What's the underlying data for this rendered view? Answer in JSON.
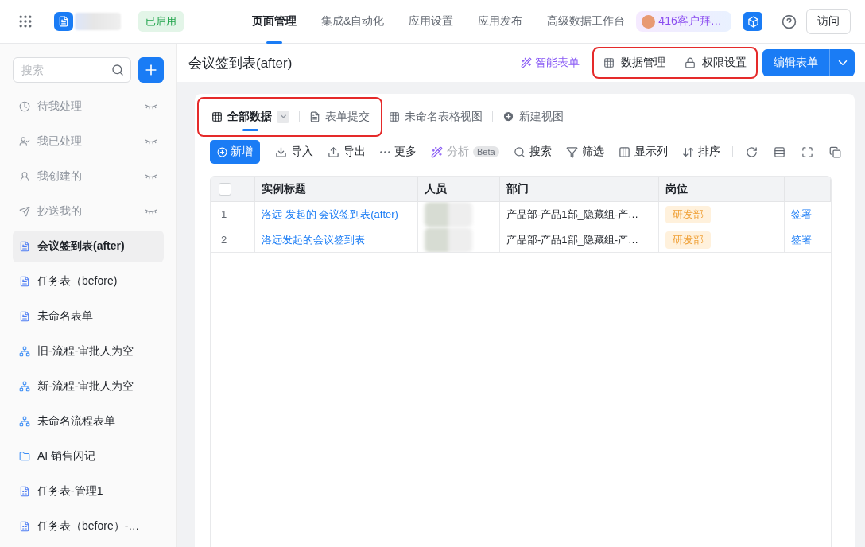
{
  "top_bar": {
    "status_badge": "已启用",
    "nav": [
      {
        "label": "页面管理",
        "selected": true
      },
      {
        "label": "集成&自动化",
        "selected": false
      },
      {
        "label": "应用设置",
        "selected": false
      },
      {
        "label": "应用发布",
        "selected": false
      },
      {
        "label": "高级数据工作台",
        "selected": false
      }
    ],
    "workspace_badge": "416客户拜…",
    "visit_button": "访问"
  },
  "sidebar": {
    "search_placeholder": "搜索",
    "items": [
      {
        "label": "待我处理",
        "kind": "pending",
        "selected": false
      },
      {
        "label": "我已处理",
        "kind": "done",
        "selected": false
      },
      {
        "label": "我创建的",
        "kind": "created",
        "selected": false
      },
      {
        "label": "抄送我的",
        "kind": "cc",
        "selected": false
      },
      {
        "label": "会议签到表(after)",
        "kind": "form",
        "selected": true
      },
      {
        "label": "任务表（before)",
        "kind": "form",
        "selected": false
      },
      {
        "label": "未命名表单",
        "kind": "form",
        "selected": false
      },
      {
        "label": "旧-流程-审批人为空",
        "kind": "flow",
        "selected": false
      },
      {
        "label": "新-流程-审批人为空",
        "kind": "flow",
        "selected": false
      },
      {
        "label": "未命名流程表单",
        "kind": "flow",
        "selected": false
      },
      {
        "label": "AI 销售闪记",
        "kind": "folder",
        "selected": false
      },
      {
        "label": "任务表-管理1",
        "kind": "report",
        "selected": false
      },
      {
        "label": "任务表（before）-…",
        "kind": "report",
        "selected": false
      }
    ]
  },
  "page_header": {
    "title": "会议签到表(after)",
    "smart_form": "智能表单",
    "highlighted_actions": [
      {
        "label": "数据管理",
        "kind": "data"
      },
      {
        "label": "权限设置",
        "kind": "permission"
      }
    ],
    "edit_button": "编辑表单"
  },
  "views": {
    "highlighted": [
      {
        "label": "全部数据",
        "kind": "table",
        "selected": true,
        "has_dropdown": true
      },
      {
        "label": "表单提交",
        "kind": "form",
        "selected": false,
        "has_dropdown": false
      }
    ],
    "others": [
      {
        "label": "未命名表格视图",
        "kind": "table",
        "selected": false,
        "has_dropdown": false
      }
    ],
    "new_view": "新建视图"
  },
  "toolbar": {
    "primary": "新增",
    "actions": [
      {
        "label": "导入",
        "kind": "import",
        "disabled": false
      },
      {
        "label": "导出",
        "kind": "export",
        "disabled": false
      },
      {
        "label": "更多",
        "kind": "more",
        "disabled": false
      },
      {
        "label": "分析",
        "kind": "analyze",
        "disabled": true,
        "badge": "Beta"
      },
      {
        "label": "搜索",
        "kind": "search",
        "disabled": false
      },
      {
        "label": "筛选",
        "kind": "filter",
        "disabled": false
      },
      {
        "label": "显示列",
        "kind": "columns",
        "disabled": false
      },
      {
        "label": "排序",
        "kind": "sort",
        "disabled": false
      }
    ]
  },
  "table": {
    "select_all_checked": false,
    "columns": [
      "实例标题",
      "人员",
      "部门",
      "岗位"
    ],
    "rows": [
      {
        "index": "1",
        "title": "洛远 发起的 会议签到表(after)",
        "department": "产品部-产品1部_隐藏组-产…",
        "position": "研发部",
        "action": "签署"
      },
      {
        "index": "2",
        "title": "洛远发起的会议签到表",
        "department": "产品部-产品1部_隐藏组-产…",
        "position": "研发部",
        "action": "签署"
      }
    ]
  }
}
